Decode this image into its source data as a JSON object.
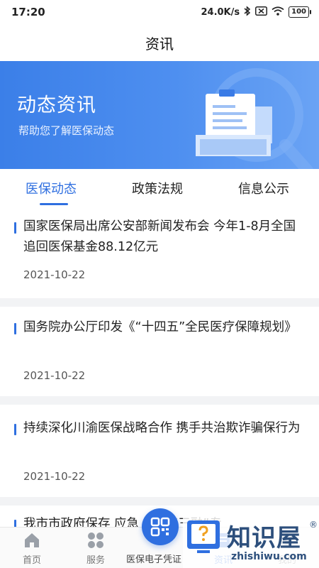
{
  "status_bar": {
    "time": "17:20",
    "speed": "24.0K/s",
    "battery": "100"
  },
  "header": {
    "title": "资讯"
  },
  "banner": {
    "title": "动态资讯",
    "subtitle": "帮助您了解医保动态"
  },
  "tabs": [
    {
      "label": "医保动态",
      "active": true
    },
    {
      "label": "政策法规",
      "active": false
    },
    {
      "label": "信息公示",
      "active": false
    }
  ],
  "news": [
    {
      "title": "国家医保局出席公安部新闻发布会 今年1-8月全国追回医保基金88.12亿元",
      "date": "2021-10-22"
    },
    {
      "title": "国务院办公厅印发《“十四五”全民医疗保障规划》",
      "date": "2021-10-22"
    },
    {
      "title": "持续深化川渝医保战略合作 携手共治欺诈骗保行为",
      "date": "2021-10-22"
    },
    {
      "title": "我市市政府保存 应急 家 例“三融”专",
      "date": ""
    }
  ],
  "bottom_nav": {
    "items": [
      {
        "label": "首页",
        "icon": "home-icon"
      },
      {
        "label": "服务",
        "icon": "grid-icon"
      },
      {
        "label": "医保电子凭证",
        "icon": "qr-code-icon"
      },
      {
        "label": "资讯",
        "icon": "news-icon"
      },
      {
        "label": "我的",
        "icon": "user-icon"
      }
    ]
  },
  "watermark": {
    "brand": "知识屋",
    "url": "zhishiwu.com",
    "reg": "®"
  },
  "colors": {
    "accent": "#2f6fe0",
    "banner_start": "#3b7fe8",
    "banner_end": "#6aa3f4"
  }
}
